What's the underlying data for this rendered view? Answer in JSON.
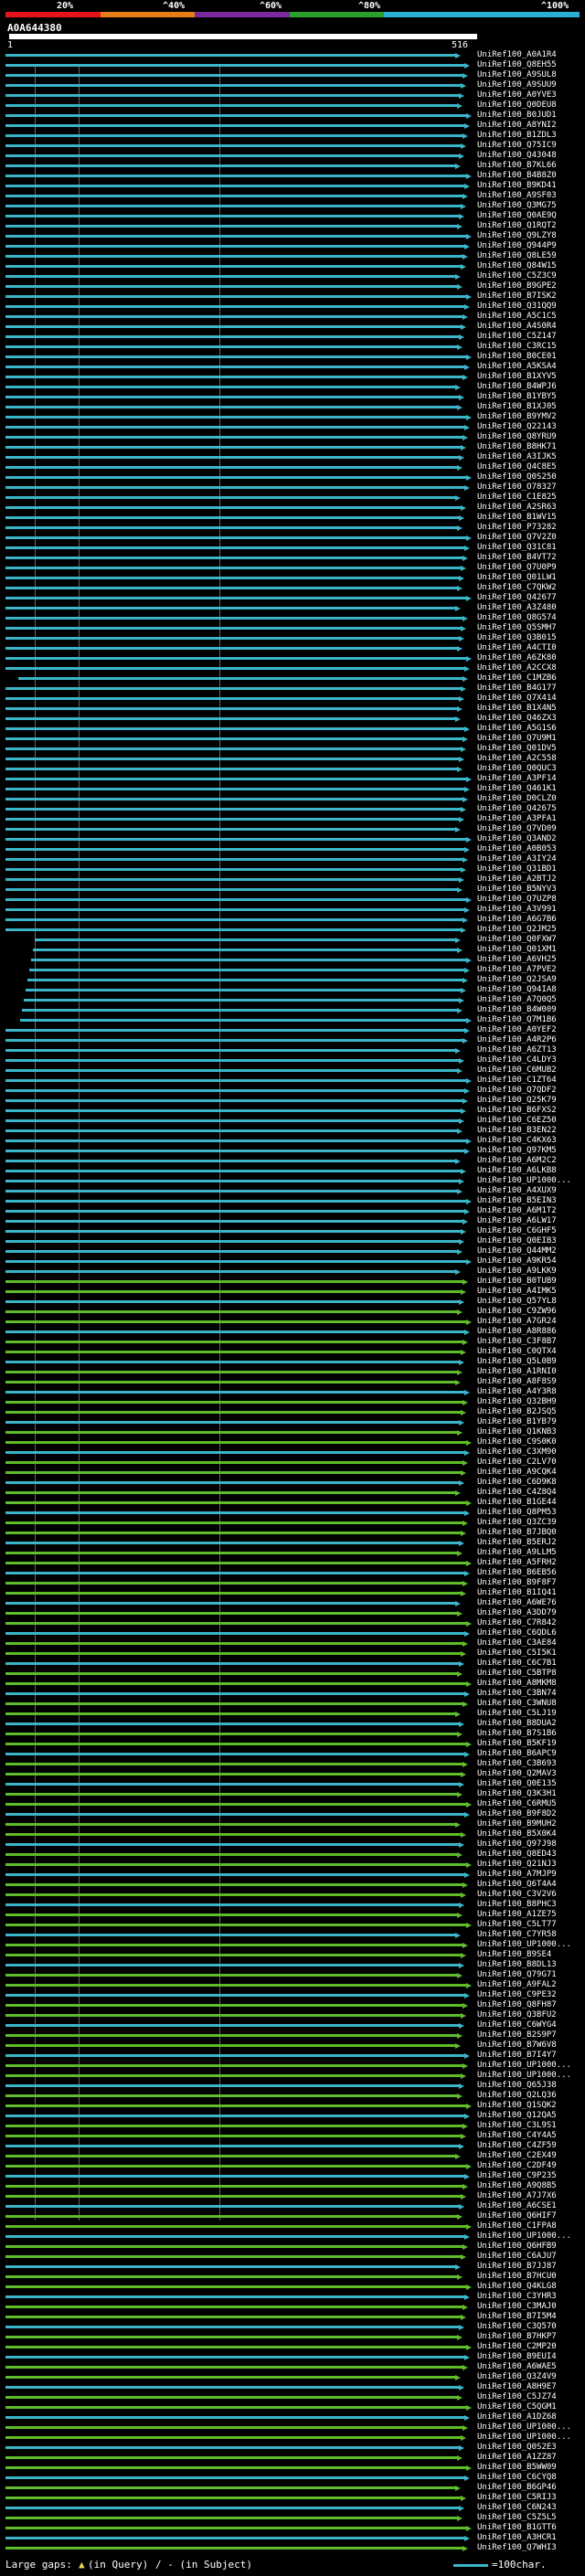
{
  "scale": {
    "labels": [
      "20%",
      "^40%",
      "^60%",
      "^80%",
      "^100%"
    ],
    "colors": [
      "#e4131c",
      "#e87d16",
      "#7b29a3",
      "#2ca02c",
      "#2ab0d4"
    ]
  },
  "query": {
    "id": "A0A644380",
    "start": "1",
    "end": "516"
  },
  "hit_colors": {
    "cyan": "#3ab5c9",
    "green": "#5fbc2a"
  },
  "hits": [
    "UniRef100_A0A1R4",
    "UniRef100_Q8EH55",
    "UniRef100_A9SUL8",
    "UniRef100_A9SUU9",
    "UniRef100_A0YVE3",
    "UniRef100_Q0DEU8",
    "UniRef100_B0JUD1",
    "UniRef100_A8YNI2",
    "UniRef100_B1ZDL3",
    "UniRef100_Q75IC9",
    "UniRef100_Q43048",
    "UniRef100_B7KL66",
    "UniRef100_B4B8Z0",
    "UniRef100_B9KD41",
    "UniRef100_A9SF03",
    "UniRef100_Q3MG75",
    "UniRef100_Q0AE9Q",
    "UniRef100_Q1RQT2",
    "UniRef100_Q9LZY8",
    "UniRef100_Q944P9",
    "UniRef100_Q8LE59",
    "UniRef100_Q84W15",
    "UniRef100_C5Z3C9",
    "UniRef100_B9GPE2",
    "UniRef100_B7ISK2",
    "UniRef100_Q31QQ9",
    "UniRef100_A5C1C5",
    "UniRef100_A4S0R4",
    "UniRef100_C5Z147",
    "UniRef100_C3RC15",
    "UniRef100_B0CE01",
    "UniRef100_A5KSA4",
    "UniRef100_B1XYV5",
    "UniRef100_B4WPJ6",
    "UniRef100_B1YBY5",
    "UniRef100_B1XJ05",
    "UniRef100_B9YMV2",
    "UniRef100_Q22143",
    "UniRef100_Q8YRU9",
    "UniRef100_B8HK71",
    "UniRef100_A3IJK5",
    "UniRef100_Q4C8E5",
    "UniRef100_Q0S250",
    "UniRef100_O78327",
    "UniRef100_C1E825",
    "UniRef100_A2SR63",
    "UniRef100_B1WV15",
    "UniRef100_P73282",
    "UniRef100_Q7V2Z0",
    "UniRef100_Q31C81",
    "UniRef100_B4VT72",
    "UniRef100_Q7U0P9",
    "UniRef100_Q01LW1",
    "UniRef100_C7QKW2",
    "UniRef100_Q42677",
    "UniRef100_A3Z480",
    "UniRef100_Q8G574",
    "UniRef100_Q5SMH7",
    "UniRef100_Q3B015",
    "UniRef100_A4CTI0",
    "UniRef100_A6ZK80",
    "UniRef100_A2CCX8",
    "UniRef100_C1MZB6",
    "UniRef100_B4G177",
    "UniRef100_Q7X414",
    "UniRef100_B1X4N5",
    "UniRef100_Q46ZX3",
    "UniRef100_A5G1S6",
    "UniRef100_Q7U9M1",
    "UniRef100_Q01DV5",
    "UniRef100_A2C558",
    "UniRef100_Q0QUC3",
    "UniRef100_A3PF14",
    "UniRef100_Q461K1",
    "UniRef100_D0CLZ0",
    "UniRef100_Q42675",
    "UniRef100_A3PFA1",
    "UniRef100_Q7VD09",
    "UniRef100_Q3AND2",
    "UniRef100_A0B053",
    "UniRef100_A3IY24",
    "UniRef100_Q31BD1",
    "UniRef100_A2BTJ2",
    "UniRef100_B5NYV3",
    "UniRef100_Q7UZP8",
    "UniRef100_A3V991",
    "UniRef100_A6G7B6",
    "UniRef100_Q2JM25",
    "UniRef100_Q0FXW7",
    "UniRef100_Q01XM1",
    "UniRef100_A6VH25",
    "UniRef100_A7PVE2",
    "UniRef100_Q2JSA9",
    "UniRef100_Q94IA8",
    "UniRef100_A7Q0Q5",
    "UniRef100_B4W009",
    "UniRef100_Q7M1B6",
    "UniRef100_A0YEF2",
    "UniRef100_A4R2P6",
    "UniRef100_A6ZT13",
    "UniRef100_C4LDY3",
    "UniRef100_C6MUB2",
    "UniRef100_C1ZT64",
    "UniRef100_Q7QDF2",
    "UniRef100_Q25K79",
    "UniRef100_B6FXS2",
    "UniRef100_C6EZ50",
    "UniRef100_B3EN22",
    "UniRef100_C4KX63",
    "UniRef100_Q97KM5",
    "UniRef100_A6M2C2",
    "UniRef100_A6LKB8",
    "UniRef100_UP1000...",
    "UniRef100_A4XUX9",
    "UniRef100_B5EIN3",
    "UniRef100_A6M1T2",
    "UniRef100_A6LW17",
    "UniRef100_C6GHF5",
    "UniRef100_Q0EIB3",
    "UniRef100_Q44MM2",
    "UniRef100_A9KR54",
    "UniRef100_A9LKK9",
    "UniRef100_B0TUB9",
    "UniRef100_A4IMK5",
    "UniRef100_Q57YL8",
    "UniRef100_C9ZW96",
    "UniRef100_A7GR24",
    "UniRef100_A8R886",
    "UniRef100_C3F8B7",
    "UniRef100_C0QTX4",
    "UniRef100_Q5L0B9",
    "UniRef100_A1RNI0",
    "UniRef100_A8F8S9",
    "UniRef100_A4Y3R8",
    "UniRef100_Q32BH9",
    "UniRef100_B2JSQ5",
    "UniRef100_B1YB79",
    "UniRef100_Q1KNB3",
    "UniRef100_C9S0K0",
    "UniRef100_C3XM90",
    "UniRef100_C2LV70",
    "UniRef100_A9CQK4",
    "UniRef100_C6D9K8",
    "UniRef100_C4Z8Q4",
    "UniRef100_B1GE44",
    "UniRef100_Q8PM53",
    "UniRef100_Q3ZC39",
    "UniRef100_B7JBQ0",
    "UniRef100_B5ERJ2",
    "UniRef100_A9LLM5",
    "UniRef100_A5FRH2",
    "UniRef100_B6EB56",
    "UniRef100_B9F8F7",
    "UniRef100_B1IQ41",
    "UniRef100_A6WE76",
    "UniRef100_A3DD79",
    "UniRef100_C7R842",
    "UniRef100_C6QDL6",
    "UniRef100_C3AE84",
    "UniRef100_C5I5K1",
    "UniRef100_C6C7B1",
    "UniRef100_C5BTP8",
    "UniRef100_A8MKM8",
    "UniRef100_C3BN74",
    "UniRef100_C3WNU8",
    "UniRef100_C5LJ19",
    "UniRef100_B8DUA2",
    "UniRef100_B7S1B6",
    "UniRef100_B5KF19",
    "UniRef100_B6APC9",
    "UniRef100_C3B693",
    "UniRef100_Q2MAV3",
    "UniRef100_Q0E135",
    "UniRef100_Q3K3H1",
    "UniRef100_C6RMU5",
    "UniRef100_B9F8D2",
    "UniRef100_B9MUH2",
    "UniRef100_B5X0K4",
    "UniRef100_Q97J98",
    "UniRef100_Q8ED43",
    "UniRef100_Q21NJ3",
    "UniRef100_A7MJP9",
    "UniRef100_Q6T4A4",
    "UniRef100_C3V2V6",
    "UniRef100_B8PHC3",
    "UniRef100_A1ZE75",
    "UniRef100_C5LT77",
    "UniRef100_C7YR58",
    "UniRef100_UP1000...",
    "UniRef100_B9SE4",
    "UniRef100_B8DL13",
    "UniRef100_Q79G71",
    "UniRef100_A9FAL2",
    "UniRef100_C9PE32",
    "UniRef100_Q8FH87",
    "UniRef100_Q3BFU2",
    "UniRef100_C6WYG4",
    "UniRef100_B2S9P7",
    "UniRef100_B7W6V8",
    "UniRef100_B7I4Y7",
    "UniRef100_UP1000...",
    "UniRef100_UP1000...",
    "UniRef100_Q65J38",
    "UniRef100_Q2LQ36",
    "UniRef100_Q1SQK2",
    "UniRef100_Q12QA5",
    "UniRef100_C3L9S1",
    "UniRef100_C4Y4A5",
    "UniRef100_C4ZF59",
    "UniRef100_C2EX49",
    "UniRef100_C2DF49",
    "UniRef100_C9P235",
    "UniRef100_A9Q8B5",
    "UniRef100_A7J7X6",
    "UniRef100_A6CSE1",
    "UniRef100_Q6HIF7",
    "UniRef100_C1FPA8",
    "UniRef100_UP1000...",
    "UniRef100_Q6HFB9",
    "UniRef100_C6AJU7",
    "UniRef100_B7JJ87",
    "UniRef100_B7HCU0",
    "UniRef100_Q4KLG8",
    "UniRef100_C3YHR3",
    "UniRef100_C3MAJ0",
    "UniRef100_B7I5M4",
    "UniRef100_C3Q570",
    "UniRef100_B7HKP7",
    "UniRef100_C2MP20",
    "UniRef100_B9EUI4",
    "UniRef100_A6WAE5",
    "UniRef100_Q3Z4V9",
    "UniRef100_A8H9E7",
    "UniRef100_C5JZ74",
    "UniRef100_C5QGM1",
    "UniRef100_A1DZ68",
    "UniRef100_UP1000...",
    "UniRef100_UP1000...",
    "UniRef100_Q0S2E3",
    "UniRef100_A1ZZ87",
    "UniRef100_B5WW09",
    "UniRef100_C6CYQ8",
    "UniRef100_B6GP46",
    "UniRef100_C5RIJ3",
    "UniRef100_C6N243",
    "UniRef100_C5Z5L5",
    "UniRef100_B1GTT6",
    "UniRef100_A3HCR1",
    "UniRef100_Q7WHI3"
  ],
  "footer": {
    "large_gaps": "Large gaps:",
    "in_query": "(in Query)",
    "in_subject": "/ - (in Subject)",
    "legend": "=100char."
  }
}
